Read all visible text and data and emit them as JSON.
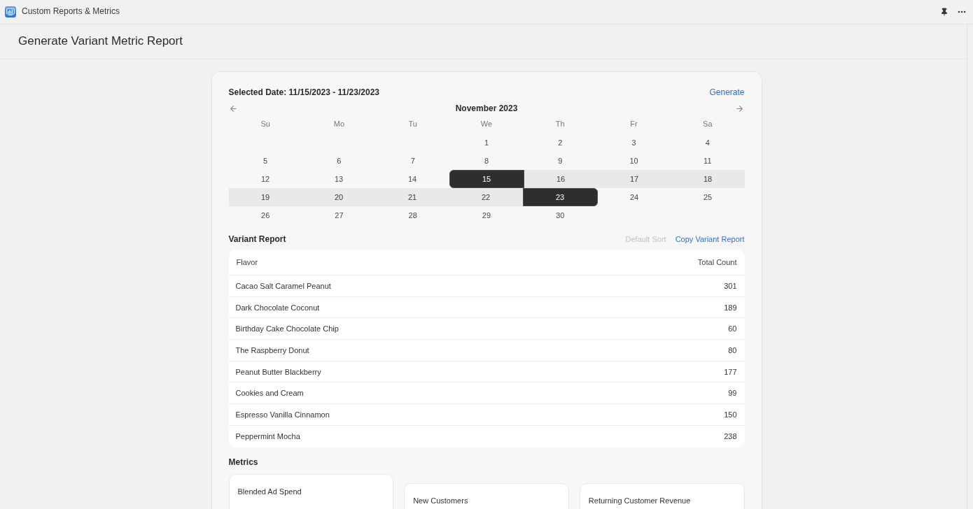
{
  "app_bar": {
    "title": "Custom Reports & Metrics"
  },
  "page": {
    "title": "Generate Variant Metric Report"
  },
  "calendar": {
    "selected_label": "Selected Date: 11/15/2023 - 11/23/2023",
    "generate_link": "Generate",
    "month": "November 2023",
    "weekdays": [
      "Su",
      "Mo",
      "Tu",
      "We",
      "Th",
      "Fr",
      "Sa"
    ],
    "weeks": [
      [
        {
          "kind": "blank"
        },
        {
          "kind": "blank"
        },
        {
          "kind": "blank"
        },
        {
          "kind": "day",
          "label": "1",
          "selected": false,
          "in_range": false
        },
        {
          "kind": "day",
          "label": "2",
          "selected": false,
          "in_range": false
        },
        {
          "kind": "day",
          "label": "3",
          "selected": false,
          "in_range": false
        },
        {
          "kind": "day",
          "label": "4",
          "selected": false,
          "in_range": false
        }
      ],
      [
        {
          "kind": "day",
          "label": "5",
          "selected": false,
          "in_range": false
        },
        {
          "kind": "day",
          "label": "6",
          "selected": false,
          "in_range": false
        },
        {
          "kind": "day",
          "label": "7",
          "selected": false,
          "in_range": false
        },
        {
          "kind": "day",
          "label": "8",
          "selected": false,
          "in_range": false
        },
        {
          "kind": "day",
          "label": "9",
          "selected": false,
          "in_range": false
        },
        {
          "kind": "day",
          "label": "10",
          "selected": false,
          "in_range": false
        },
        {
          "kind": "day",
          "label": "11",
          "selected": false,
          "in_range": false
        }
      ],
      [
        {
          "kind": "day",
          "label": "12",
          "selected": false,
          "in_range": false
        },
        {
          "kind": "day",
          "label": "13",
          "selected": false,
          "in_range": false
        },
        {
          "kind": "day",
          "label": "14",
          "selected": false,
          "in_range": false
        },
        {
          "kind": "day",
          "label": "15",
          "selected": true,
          "in_range": true
        },
        {
          "kind": "day",
          "label": "16",
          "selected": false,
          "in_range": true
        },
        {
          "kind": "day",
          "label": "17",
          "selected": false,
          "in_range": true
        },
        {
          "kind": "day",
          "label": "18",
          "selected": false,
          "in_range": true
        }
      ],
      [
        {
          "kind": "day",
          "label": "19",
          "selected": false,
          "in_range": true
        },
        {
          "kind": "day",
          "label": "20",
          "selected": false,
          "in_range": true
        },
        {
          "kind": "day",
          "label": "21",
          "selected": false,
          "in_range": true
        },
        {
          "kind": "day",
          "label": "22",
          "selected": false,
          "in_range": true
        },
        {
          "kind": "day",
          "label": "23",
          "selected": true,
          "in_range": true
        },
        {
          "kind": "day",
          "label": "24",
          "selected": false,
          "in_range": false
        },
        {
          "kind": "day",
          "label": "25",
          "selected": false,
          "in_range": false
        }
      ],
      [
        {
          "kind": "day",
          "label": "26",
          "selected": false,
          "in_range": false
        },
        {
          "kind": "day",
          "label": "27",
          "selected": false,
          "in_range": false
        },
        {
          "kind": "day",
          "label": "28",
          "selected": false,
          "in_range": false
        },
        {
          "kind": "day",
          "label": "29",
          "selected": false,
          "in_range": false
        },
        {
          "kind": "day",
          "label": "30",
          "selected": false,
          "in_range": false
        }
      ]
    ]
  },
  "variant_report": {
    "title": "Variant Report",
    "sort_button": {
      "label": "Default Sort",
      "disabled": true
    },
    "copy_link": "Copy Variant Report",
    "columns": [
      "Flavor",
      "Total Count"
    ],
    "rows": [
      {
        "flavor": "Cacao Salt Caramel Peanut",
        "total_count": "301"
      },
      {
        "flavor": "Dark Chocolate Coconut",
        "total_count": "189"
      },
      {
        "flavor": "Birthday Cake Chocolate Chip",
        "total_count": "60"
      },
      {
        "flavor": "The Raspberry Donut",
        "total_count": "80"
      },
      {
        "flavor": "Peanut Butter Blackberry",
        "total_count": "177"
      },
      {
        "flavor": "Cookies and Cream",
        "total_count": "99"
      },
      {
        "flavor": "Espresso Vanilla Cinnamon",
        "total_count": "150"
      },
      {
        "flavor": "Peppermint Mocha",
        "total_count": "238"
      }
    ]
  },
  "metrics": {
    "title": "Metrics",
    "cards": [
      {
        "title": "Blended Ad Spend"
      },
      {
        "title": "New Customers"
      },
      {
        "title": "Returning Customer Revenue"
      }
    ]
  }
}
